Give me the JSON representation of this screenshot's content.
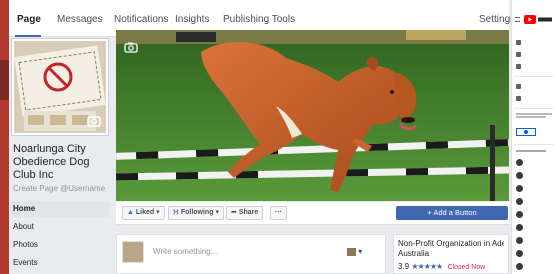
{
  "nav": {
    "tabs": [
      "Page",
      "Messages",
      "Notifications",
      "Insights",
      "Publishing Tools"
    ],
    "settings": "Settings"
  },
  "profile": {
    "name": "Noarlunga City Obedience Dog Club Inc",
    "username_link": "Create Page @Username",
    "menu": [
      "Home",
      "About",
      "Photos",
      "Events"
    ]
  },
  "actions": {
    "liked": "Liked",
    "following": "Following",
    "share": "Share",
    "more": "···",
    "add_button": "+ Add a Button"
  },
  "composer": {
    "placeholder": "Write something..."
  },
  "about": {
    "category_line1": "Non-Profit Organization in Adelaide,",
    "category_line2": "Australia",
    "rating": "3.9",
    "stars": "★★★★★",
    "status": "Closed Now"
  },
  "colors": {
    "accent": "#4267b2",
    "closed": "#f02849"
  }
}
